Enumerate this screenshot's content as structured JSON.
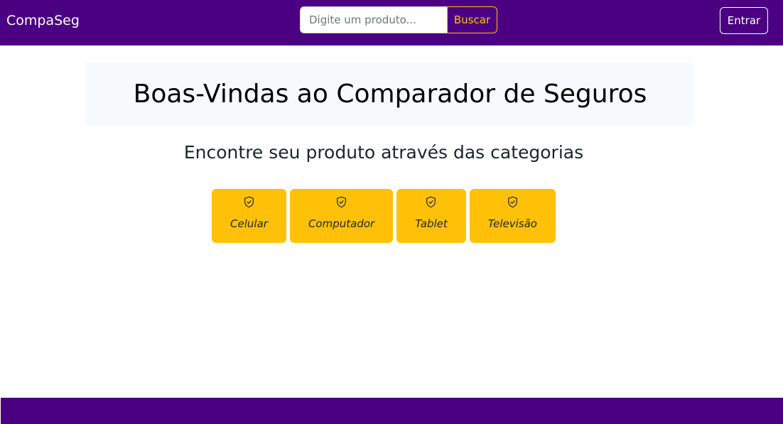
{
  "navbar": {
    "brand": "CompaSeg",
    "search": {
      "placeholder": "Digite um produto...",
      "value": "",
      "button_label": "Buscar"
    },
    "login_label": "Entrar"
  },
  "hero": {
    "title": "Boas-Vindas ao Comparador de Seguros"
  },
  "categories_section": {
    "title": "Encontre seu produto através das categorias",
    "items": [
      {
        "label": "Celular",
        "icon": "shield-check-icon"
      },
      {
        "label": "Computador",
        "icon": "shield-check-icon"
      },
      {
        "label": "Tablet",
        "icon": "shield-check-icon"
      },
      {
        "label": "Televisão",
        "icon": "shield-check-icon"
      }
    ]
  },
  "colors": {
    "primary": "#4b0082",
    "accent": "#ffc107",
    "hero_background": "#f8f9fa",
    "text": "#212529"
  }
}
